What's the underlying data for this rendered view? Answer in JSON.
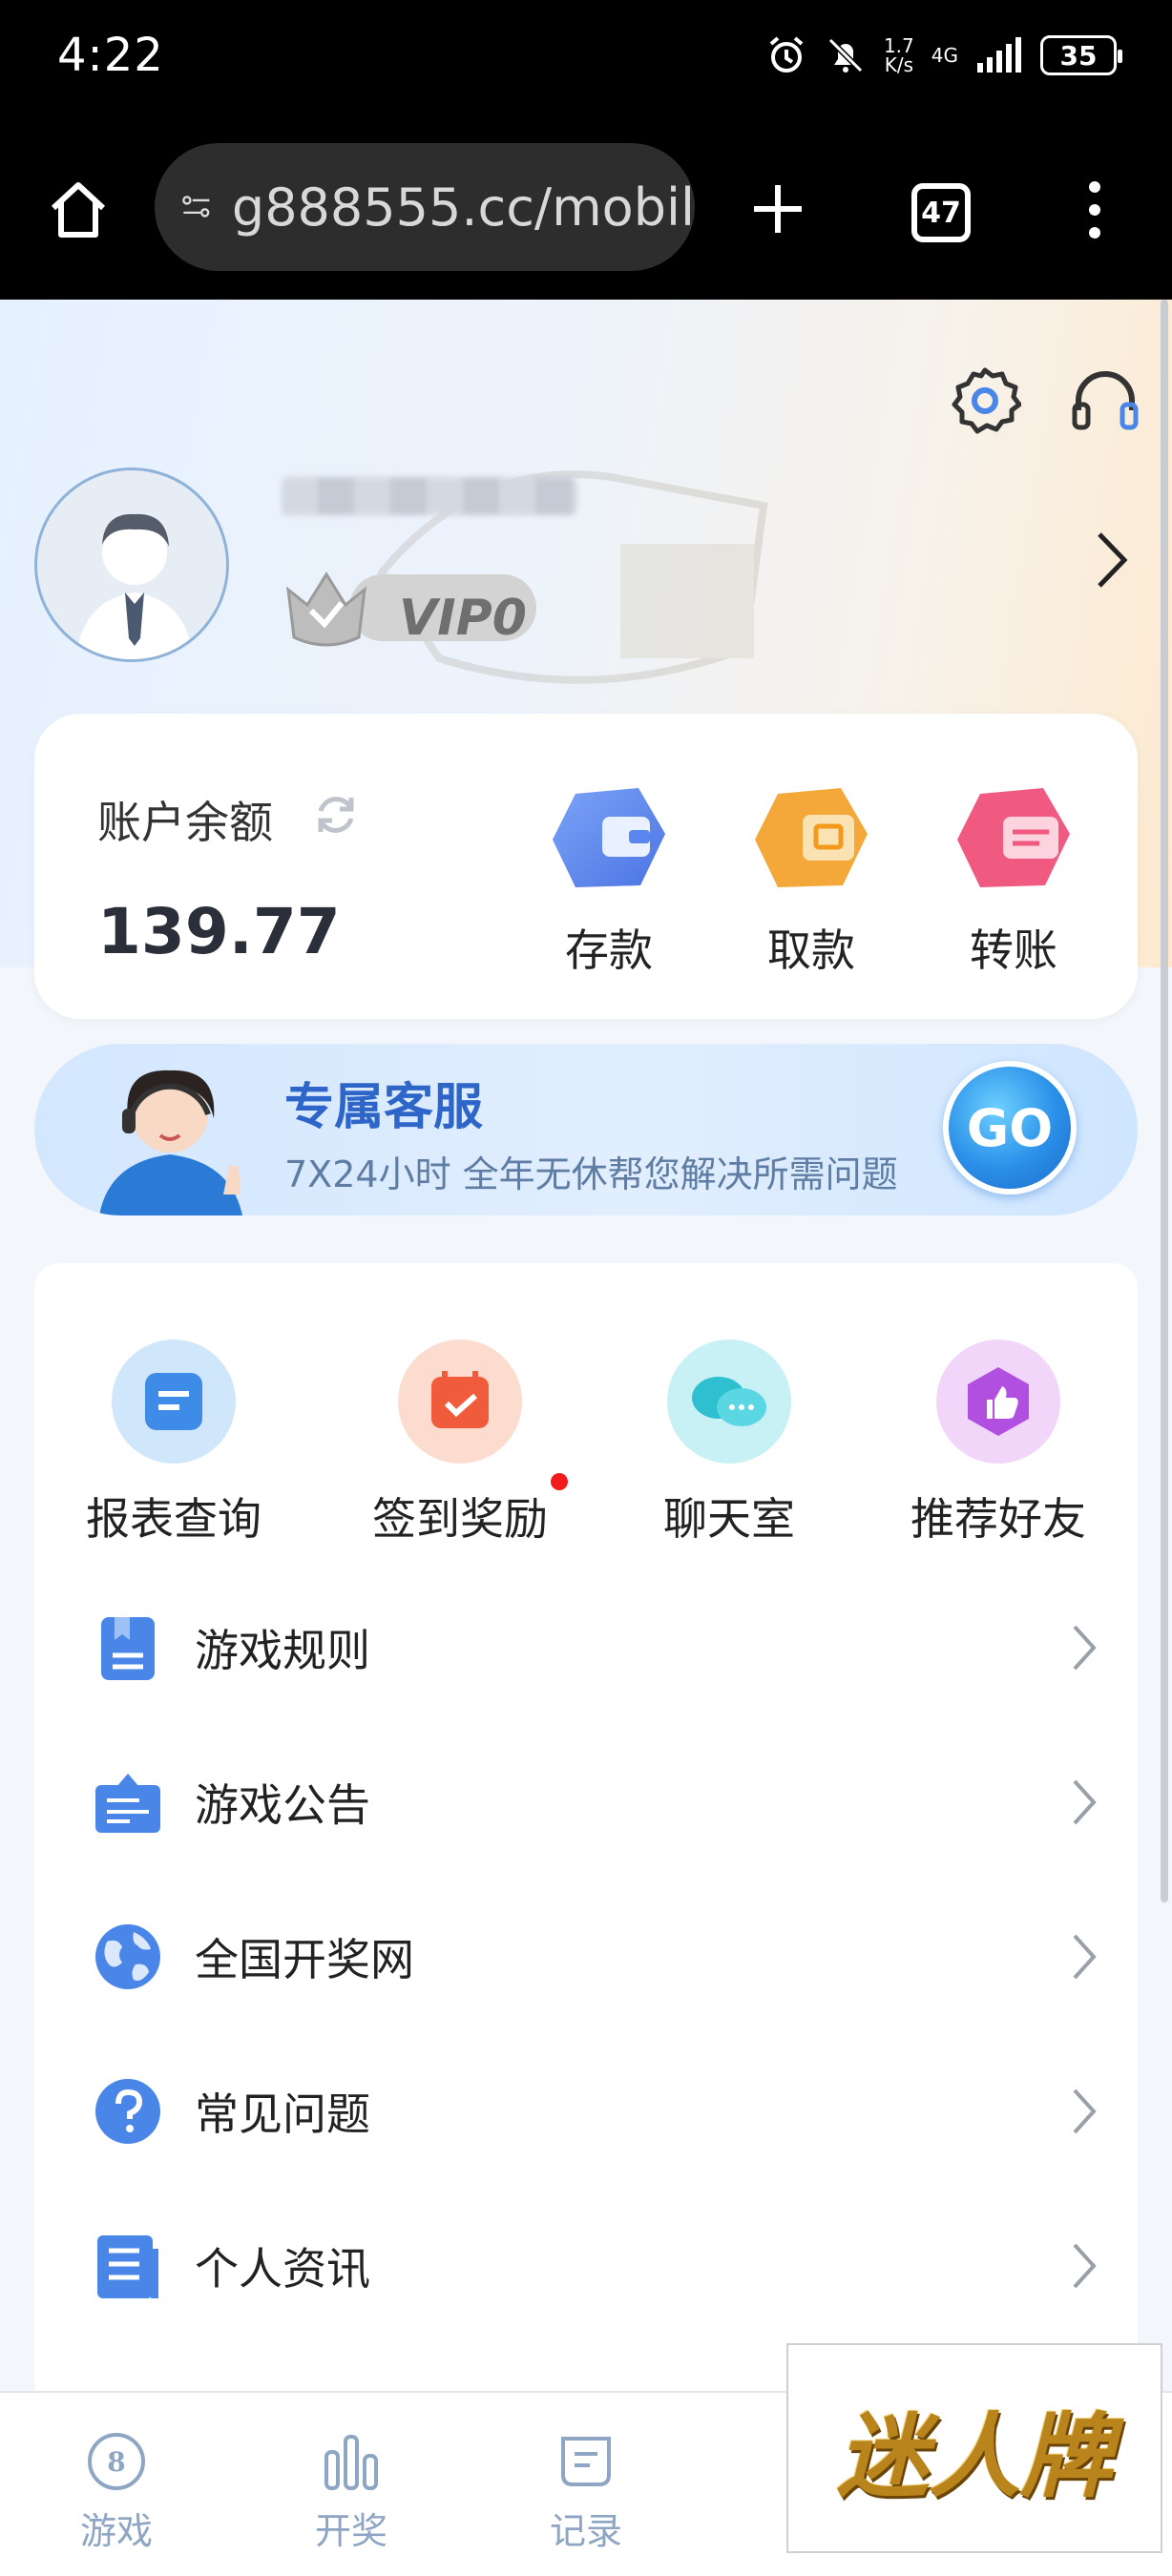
{
  "status_bar": {
    "time": "4:22",
    "net_speed_top": "1.7",
    "net_speed_bottom": "K/s",
    "network": "4G",
    "battery": "35"
  },
  "browser": {
    "url": "g888555.cc/mobil",
    "tab_count": "47"
  },
  "profile": {
    "vip_level": "VIP0"
  },
  "balance": {
    "label": "账户余额",
    "value": "139.77"
  },
  "actions": [
    {
      "label": "存款",
      "color": "#4f7ff0"
    },
    {
      "label": "取款",
      "color": "#f4a02c"
    },
    {
      "label": "转账",
      "color": "#f0547a"
    }
  ],
  "service_banner": {
    "title": "专属客服",
    "subtitle": "7X24小时 全年无休帮您解决所需问题",
    "button": "GO"
  },
  "quick_links": [
    {
      "label": "报表查询",
      "icon": "report-icon"
    },
    {
      "label": "签到奖励",
      "icon": "checkin-icon",
      "badge": true
    },
    {
      "label": "聊天室",
      "icon": "chat-icon"
    },
    {
      "label": "推荐好友",
      "icon": "thumbs-up-icon"
    }
  ],
  "menu_rows": [
    {
      "label": "游戏规则",
      "icon": "rules-book-icon"
    },
    {
      "label": "游戏公告",
      "icon": "notice-board-icon"
    },
    {
      "label": "全国开奖网",
      "icon": "globe-icon"
    },
    {
      "label": "常见问题",
      "icon": "question-icon"
    },
    {
      "label": "个人资讯",
      "icon": "profile-doc-icon"
    }
  ],
  "bottom_nav": [
    {
      "label": "游戏",
      "icon": "game-icon"
    },
    {
      "label": "开奖",
      "icon": "bar-chart-icon"
    },
    {
      "label": "记录",
      "icon": "record-icon"
    }
  ],
  "watermark": {
    "text": "迷人牌"
  },
  "colors": {
    "accent": "#4a86e8",
    "service_title": "#2e65c8",
    "nav_inactive": "#8ea6c3"
  }
}
